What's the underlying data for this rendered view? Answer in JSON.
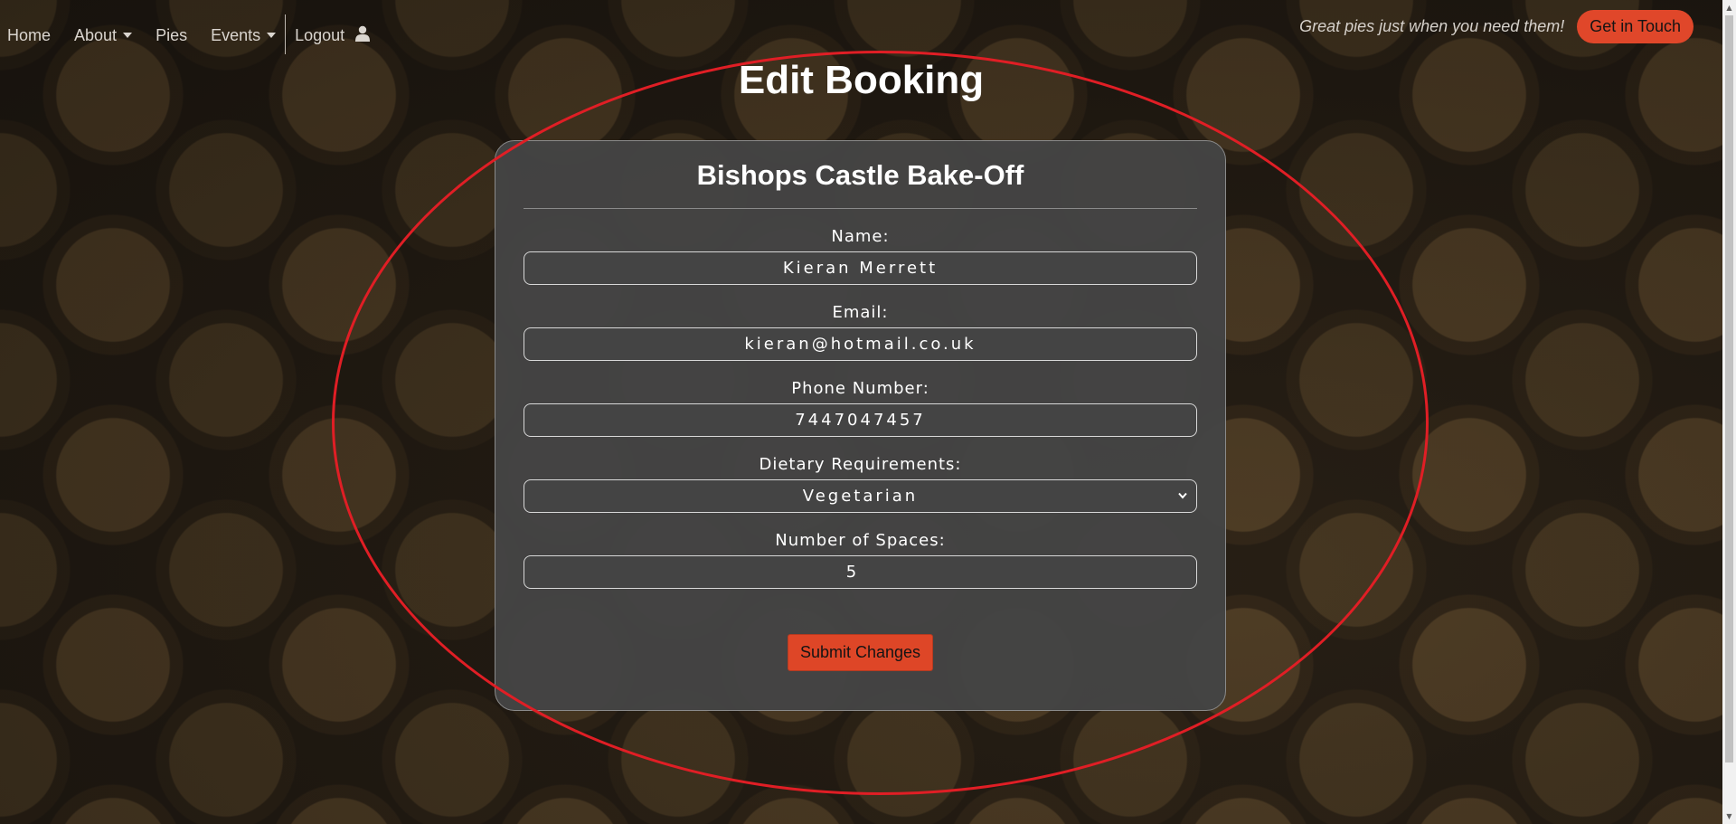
{
  "nav": {
    "home": "Home",
    "about": "About",
    "pies": "Pies",
    "events": "Events",
    "logout": "Logout",
    "user_icon": "user-icon",
    "tagline": "Great pies just when you need them!",
    "cta": "Get in Touch"
  },
  "page": {
    "title": "Edit Booking"
  },
  "card": {
    "event_name": "Bishops Castle Bake-Off",
    "fields": {
      "name": {
        "label": "Name:",
        "value": "Kieran Merrett"
      },
      "email": {
        "label": "Email:",
        "value": "kieran@hotmail.co.uk"
      },
      "phone": {
        "label": "Phone Number:",
        "value": "7447047457"
      },
      "dietary": {
        "label": "Dietary Requirements:",
        "value": "Vegetarian"
      },
      "spaces": {
        "label": "Number of Spaces:",
        "value": "5"
      }
    },
    "submit": "Submit Changes"
  },
  "colors": {
    "accent": "#e0472a",
    "annotation": "#e01e25",
    "card_bg": "#444444"
  }
}
